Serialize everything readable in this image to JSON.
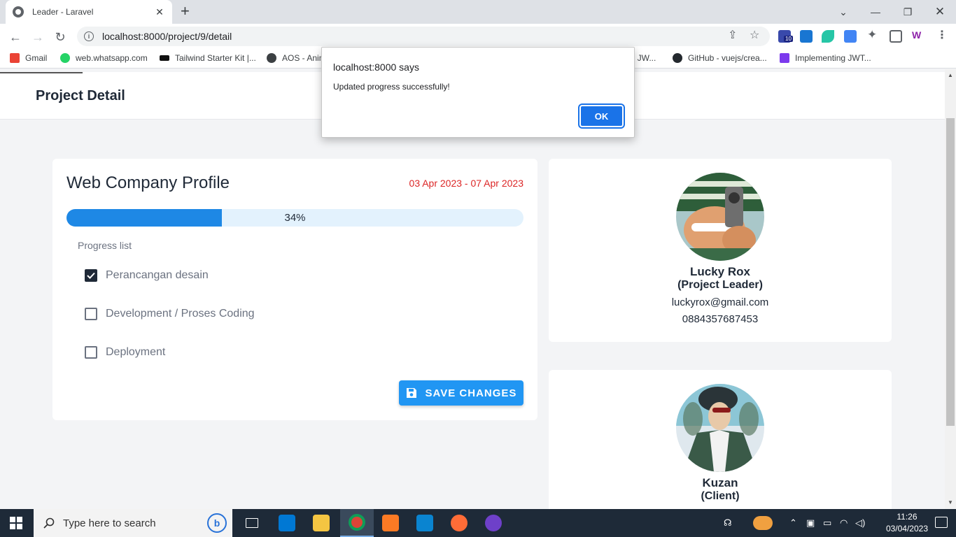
{
  "browser": {
    "tab_title": "Leader - Laravel",
    "url": "localhost:8000/project/9/detail",
    "extension_badge": "10",
    "bookmarks": [
      {
        "label": "Gmail",
        "color": "#ea4335"
      },
      {
        "label": "web.whatsapp.com",
        "color": "#25d366"
      },
      {
        "label": "Tailwind Starter Kit |...",
        "color": "#111111"
      },
      {
        "label": "AOS - Anim",
        "color": "#3c4043"
      },
      {
        "label": "el JW...",
        "color": "#ffffff"
      },
      {
        "label": "GitHub - vuejs/crea...",
        "color": "#24292e"
      },
      {
        "label": "Implementing JWT...",
        "color": "#7c3aed"
      }
    ]
  },
  "dialog": {
    "origin": "localhost:8000 says",
    "message": "Updated progress successfully!",
    "ok_label": "OK"
  },
  "page": {
    "title": "Project Detail"
  },
  "project": {
    "name": "Web Company Profile",
    "dates": "03 Apr 2023 - 07 Apr 2023",
    "progress_percent": 34,
    "progress_label": "34%",
    "progress_list_label": "Progress list",
    "tasks": [
      {
        "label": "Perancangan desain",
        "checked": true
      },
      {
        "label": "Development / Proses Coding",
        "checked": false
      },
      {
        "label": "Deployment",
        "checked": false
      }
    ],
    "save_label": "SAVE CHANGES"
  },
  "leader": {
    "name": "Lucky Rox",
    "role": "(Project Leader)",
    "email": "luckyrox@gmail.com",
    "phone": "0884357687453"
  },
  "client": {
    "name": "Kuzan",
    "role": "(Client)"
  },
  "taskbar": {
    "search_placeholder": "Type here to search",
    "time": "11:26",
    "date": "03/04/2023"
  },
  "colors": {
    "accent": "#2196f3",
    "progress_fill": "#1e88e5",
    "progress_track": "#e3f2fd",
    "date_red": "#dc2626"
  }
}
